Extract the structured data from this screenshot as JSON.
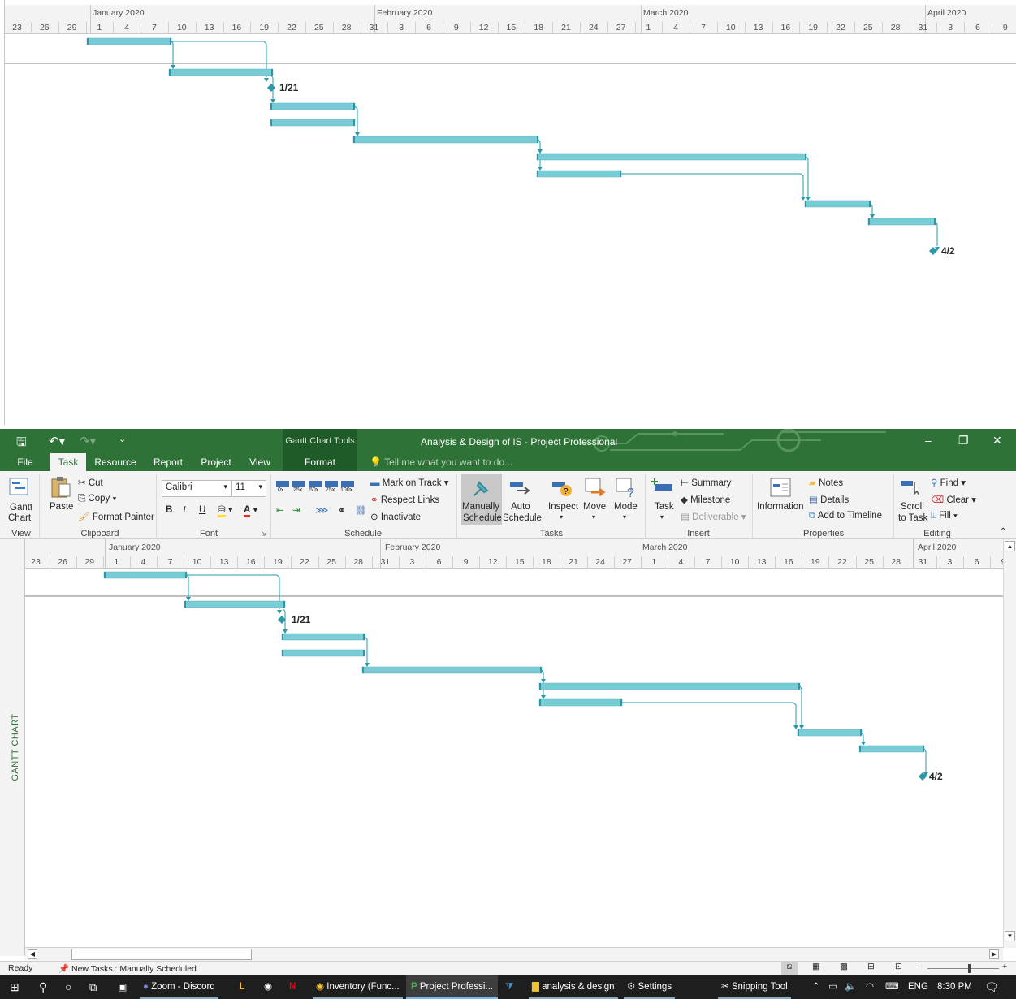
{
  "timeline": {
    "months": [
      "January 2020",
      "February 2020",
      "March 2020",
      "April 2020"
    ],
    "days": [
      "23",
      "26",
      "29",
      "1",
      "4",
      "7",
      "10",
      "13",
      "16",
      "19",
      "22",
      "25",
      "28",
      "31",
      "3",
      "6",
      "9",
      "12",
      "15",
      "18",
      "21",
      "24",
      "27",
      "1",
      "4",
      "7",
      "10",
      "13",
      "16",
      "19",
      "22",
      "25",
      "28",
      "31",
      "3",
      "6",
      "9"
    ]
  },
  "milestones": {
    "first": "1/21",
    "last": "4/2"
  },
  "title_bar": {
    "title": "Analysis & Design of IS - Project Professional",
    "context_tab_group": "Gantt Chart Tools"
  },
  "tabs": [
    "File",
    "Task",
    "Resource",
    "Report",
    "Project",
    "View",
    "Format"
  ],
  "active_tab": "Task",
  "tell_me": "Tell me what you want to do...",
  "ribbon": {
    "view": {
      "gantt_chart_l1": "Gantt",
      "gantt_chart_l2": "Chart",
      "group": "View"
    },
    "clipboard": {
      "paste": "Paste",
      "cut": "Cut",
      "copy": "Copy",
      "format_painter": "Format Painter",
      "group": "Clipboard"
    },
    "font": {
      "family": "Calibri",
      "size": "11",
      "bold": "B",
      "italic": "I",
      "underline": "U",
      "font_color": "A",
      "group": "Font"
    },
    "schedule": {
      "pcts": [
        "0x",
        "25x",
        "50x",
        "75x",
        "100x"
      ],
      "mark_on_track": "Mark on Track",
      "respect_links": "Respect Links",
      "inactivate": "Inactivate",
      "group": "Schedule"
    },
    "tasks": {
      "manually_l1": "Manually",
      "manually_l2": "Schedule",
      "auto_l1": "Auto",
      "auto_l2": "Schedule",
      "inspect": "Inspect",
      "move": "Move",
      "mode": "Mode",
      "group": "Tasks"
    },
    "insert": {
      "task": "Task",
      "summary": "Summary",
      "milestone": "Milestone",
      "deliverable": "Deliverable",
      "group": "Insert"
    },
    "properties": {
      "information": "Information",
      "notes": "Notes",
      "details": "Details",
      "add_to_timeline": "Add to Timeline",
      "group": "Properties"
    },
    "editing": {
      "scroll_l1": "Scroll",
      "scroll_l2": "to Task",
      "find": "Find",
      "clear": "Clear",
      "fill": "Fill",
      "group": "Editing"
    }
  },
  "side_label": "GANTT CHART",
  "status": {
    "ready": "Ready",
    "new_tasks": "New Tasks : Manually Scheduled"
  },
  "taskbar": {
    "apps": [
      "Zoom - Discord",
      "Inventory (Func...",
      "Project Professi...",
      "analysis & design",
      "Settings",
      "Snipping Tool"
    ],
    "lang": "ENG",
    "time": "8:30 PM"
  }
}
